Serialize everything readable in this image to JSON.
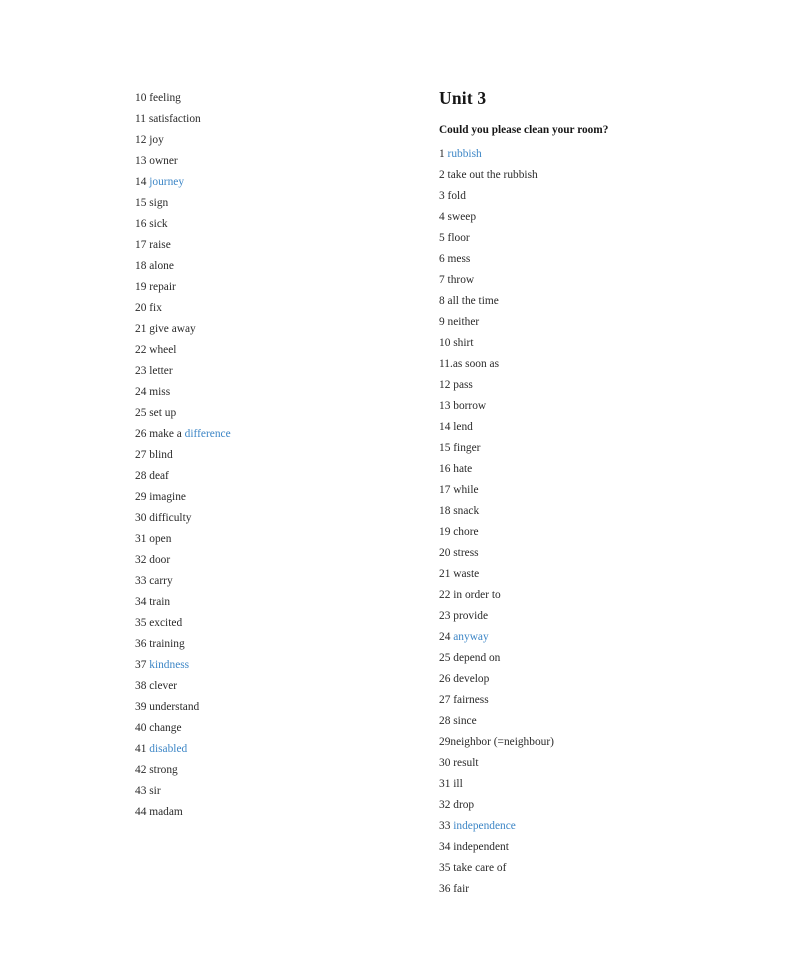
{
  "document": {
    "type": "vocabulary-word-list",
    "page_background": "#ffffff",
    "text_color": "#2a2a2a",
    "link_color": "#3d86c6"
  },
  "left_column": {
    "items": [
      {
        "number": "10",
        "term": "feeling",
        "link": false
      },
      {
        "number": "11",
        "term": "satisfaction",
        "link": false
      },
      {
        "number": "12",
        "term": "joy",
        "link": false
      },
      {
        "number": "13",
        "term": "owner",
        "link": false
      },
      {
        "number": "14",
        "term": "journey",
        "link": true
      },
      {
        "number": "15",
        "term": "sign",
        "link": false
      },
      {
        "number": "16",
        "term": "sick",
        "link": false
      },
      {
        "number": "17",
        "term": "raise",
        "link": false
      },
      {
        "number": "18",
        "term": "alone",
        "link": false
      },
      {
        "number": "19",
        "term": "repair",
        "link": false
      },
      {
        "number": "20",
        "term": "fix",
        "link": false
      },
      {
        "number": "21",
        "term": "give away",
        "link": false
      },
      {
        "number": "22",
        "term": "wheel",
        "link": false
      },
      {
        "number": "23",
        "term": "letter",
        "link": false
      },
      {
        "number": "24",
        "term": "miss",
        "link": false
      },
      {
        "number": "25",
        "term": "set up",
        "link": false
      },
      {
        "number": "26",
        "term": "make a ",
        "term_link": "difference",
        "link": false
      },
      {
        "number": "27",
        "term": "blind",
        "link": false
      },
      {
        "number": "28",
        "term": "deaf",
        "link": false
      },
      {
        "number": "29",
        "term": "imagine",
        "link": false
      },
      {
        "number": "30",
        "term": "difficulty",
        "link": false
      },
      {
        "number": "31",
        "term": "open",
        "link": false
      },
      {
        "number": "32",
        "term": "door",
        "link": false
      },
      {
        "number": "33",
        "term": "carry",
        "link": false
      },
      {
        "number": "34",
        "term": "train",
        "link": false
      },
      {
        "number": "35",
        "term": "excited",
        "link": false
      },
      {
        "number": "36",
        "term": "training",
        "link": false
      },
      {
        "number": "37",
        "term": "kindness",
        "link": true
      },
      {
        "number": "38",
        "term": "clever",
        "link": false
      },
      {
        "number": "39",
        "term": "understand",
        "link": false
      },
      {
        "number": "40",
        "term": "change",
        "link": false
      },
      {
        "number": "41",
        "term": "disabled",
        "link": true
      },
      {
        "number": "42",
        "term": "strong",
        "link": false
      },
      {
        "number": "43",
        "term": "sir",
        "link": false
      },
      {
        "number": "44",
        "term": "madam",
        "link": false
      }
    ]
  },
  "right_column": {
    "unit_heading": "Unit 3",
    "section_subtitle": "Could you please clean your room?",
    "items": [
      {
        "number": "1",
        "term": "rubbish",
        "link": true
      },
      {
        "number": "2",
        "term": "take out the rubbish",
        "link": false
      },
      {
        "number": "3",
        "term": "fold",
        "link": false
      },
      {
        "number": "4",
        "term": "sweep",
        "link": false
      },
      {
        "number": "5",
        "term": "floor",
        "link": false
      },
      {
        "number": "6",
        "term": "mess",
        "link": false
      },
      {
        "number": "7",
        "term": "throw",
        "link": false
      },
      {
        "number": "8",
        "term": "all the time",
        "link": false
      },
      {
        "number": "9",
        "term": "neither",
        "link": false
      },
      {
        "number": "10",
        "term": "shirt",
        "link": false
      },
      {
        "number": "11.",
        "term": "as soon as",
        "link": false,
        "no_space": true
      },
      {
        "number": "12",
        "term": "pass",
        "link": false
      },
      {
        "number": "13",
        "term": "borrow",
        "link": false
      },
      {
        "number": "14",
        "term": "lend",
        "link": false
      },
      {
        "number": "15",
        "term": "finger",
        "link": false
      },
      {
        "number": "16",
        "term": "hate",
        "link": false
      },
      {
        "number": "17",
        "term": "while",
        "link": false
      },
      {
        "number": "18",
        "term": "snack",
        "link": false
      },
      {
        "number": "19",
        "term": "chore",
        "link": false
      },
      {
        "number": "20",
        "term": "stress",
        "link": false
      },
      {
        "number": "21",
        "term": "waste",
        "link": false
      },
      {
        "number": "22",
        "term": "in order to",
        "link": false
      },
      {
        "number": "23",
        "term": "provide",
        "link": false
      },
      {
        "number": "24",
        "term": "anyway",
        "link": true
      },
      {
        "number": "25",
        "term": "depend on",
        "link": false
      },
      {
        "number": "26",
        "term": "develop",
        "link": false
      },
      {
        "number": "27",
        "term": "fairness",
        "link": false
      },
      {
        "number": "28",
        "term": "since",
        "link": false
      },
      {
        "number": "29",
        "term": "neighbor (=neighbour)",
        "link": false,
        "no_space": true
      },
      {
        "number": "30",
        "term": "result",
        "link": false
      },
      {
        "number": "31",
        "term": "ill",
        "link": false
      },
      {
        "number": "32",
        "term": "drop",
        "link": false
      },
      {
        "number": "33",
        "term": "independence",
        "link": true
      },
      {
        "number": "34",
        "term": "independent",
        "link": false
      },
      {
        "number": "35",
        "term": "take care of",
        "link": false
      },
      {
        "number": "36",
        "term": "fair",
        "link": false
      }
    ]
  }
}
